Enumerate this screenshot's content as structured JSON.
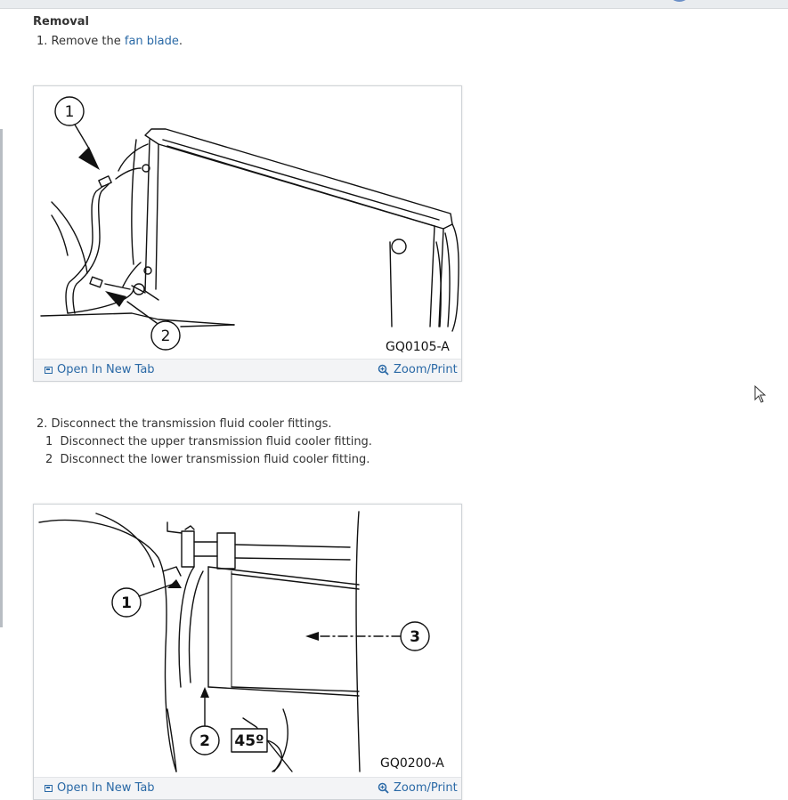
{
  "removal": {
    "title": "Removal",
    "step1_prefix": "1. Remove the ",
    "step1_link": "fan blade",
    "step1_suffix": ".",
    "step2": "2. Disconnect the transmission fluid cooler fittings.",
    "step2_sub": [
      {
        "num": "1",
        "text": "Disconnect the upper transmission fluid cooler fitting."
      },
      {
        "num": "2",
        "text": "Disconnect the lower transmission fluid cooler fitting."
      }
    ]
  },
  "figures": [
    {
      "code": "GQ0105-A",
      "callouts": [
        "1",
        "2"
      ],
      "open_label": "Open In New Tab",
      "zoom_label": "Zoom/Print"
    },
    {
      "code": "GQ0200-A",
      "callouts": [
        "1",
        "2",
        "3"
      ],
      "angle_label": "45º",
      "open_label": "Open In New Tab",
      "zoom_label": "Zoom/Print"
    }
  ],
  "icons": {
    "open_tab": "open-new-tab-icon",
    "zoom": "magnifier-plus-icon",
    "cursor": "mouse-pointer-icon"
  },
  "colors": {
    "link": "#2a69a6",
    "text": "#333333",
    "bar": "#f3f4f6"
  }
}
